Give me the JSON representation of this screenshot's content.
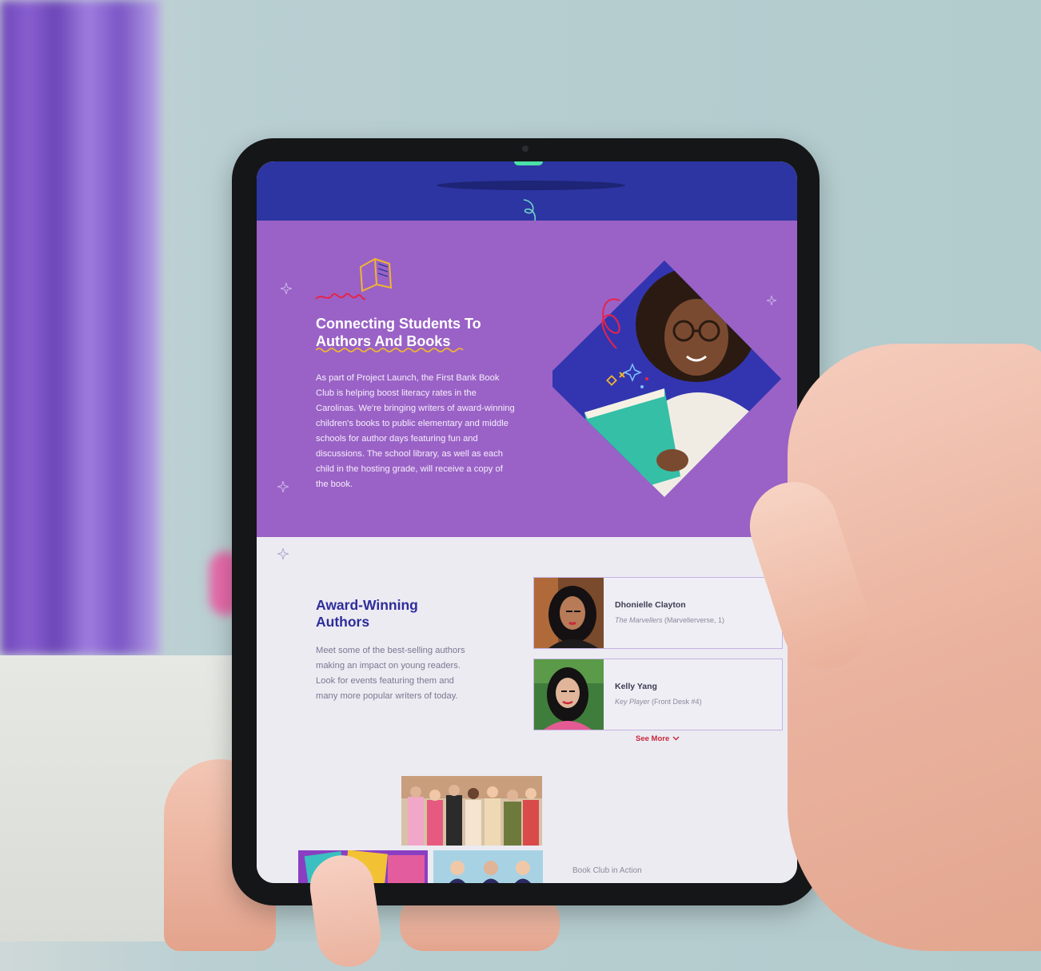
{
  "hero": {
    "title_line1": "Connecting Students To",
    "title_line2": "Authors And Books",
    "body": "As part of Project Launch, the First Bank Book Club is helping boost literacy rates in the Carolinas. We're bringing writers of award-winning children's books to public elementary and middle schools for author days featuring fun and discussions. The school library, as well as each child in the hosting grade, will receive a copy of the book."
  },
  "authors": {
    "title_line1": "Award-Winning",
    "title_line2": "Authors",
    "body": "Meet some of the best-selling authors making an impact on young readers. Look for events featuring them and many more popular writers of today.",
    "cards": [
      {
        "name": "Dhonielle Clayton",
        "book_title": "The Marvellers",
        "series": "(Marvellerverse, 1)"
      },
      {
        "name": "Kelly Yang",
        "book_title": "Key Player",
        "series": "(Front Desk #4)"
      }
    ],
    "see_more": "See More"
  },
  "gallery": {
    "caption": "Book Club in Action"
  },
  "colors": {
    "navy_band": "#2d35a2",
    "hero_purple": "#9a62c6",
    "heading_blue": "#2e2d9b",
    "accent_red": "#c8283b",
    "mint": "#4be0a8"
  }
}
